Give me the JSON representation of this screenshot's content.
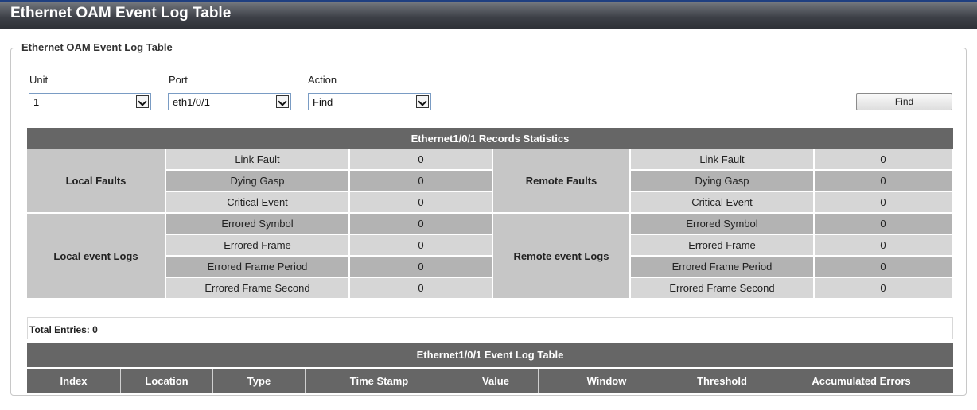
{
  "window": {
    "title": "Ethernet OAM Event Log Table"
  },
  "panel": {
    "legend": "Ethernet OAM Event Log Table"
  },
  "filters": {
    "unit": {
      "label": "Unit",
      "value": "1"
    },
    "port": {
      "label": "Port",
      "value": "eth1/0/1"
    },
    "action": {
      "label": "Action",
      "value": "Find"
    },
    "find_button": "Find"
  },
  "stats": {
    "header": "Ethernet1/0/1 Records Statistics",
    "local_faults": {
      "label": "Local Faults",
      "rows": [
        {
          "name": "Link Fault",
          "value": "0"
        },
        {
          "name": "Dying Gasp",
          "value": "0"
        },
        {
          "name": "Critical Event",
          "value": "0"
        }
      ]
    },
    "remote_faults": {
      "label": "Remote Faults",
      "rows": [
        {
          "name": "Link Fault",
          "value": "0"
        },
        {
          "name": "Dying Gasp",
          "value": "0"
        },
        {
          "name": "Critical Event",
          "value": "0"
        }
      ]
    },
    "local_event_logs": {
      "label": "Local event Logs",
      "rows": [
        {
          "name": "Errored Symbol",
          "value": "0"
        },
        {
          "name": "Errored Frame",
          "value": "0"
        },
        {
          "name": "Errored Frame Period",
          "value": "0"
        },
        {
          "name": "Errored Frame Second",
          "value": "0"
        }
      ]
    },
    "remote_event_logs": {
      "label": "Remote event Logs",
      "rows": [
        {
          "name": "Errored Symbol",
          "value": "0"
        },
        {
          "name": "Errored Frame",
          "value": "0"
        },
        {
          "name": "Errored Frame Period",
          "value": "0"
        },
        {
          "name": "Errored Frame Second",
          "value": "0"
        }
      ]
    }
  },
  "log": {
    "total_entries": "Total Entries: 0",
    "header": "Ethernet1/0/1 Event Log Table",
    "columns": [
      "Index",
      "Location",
      "Type",
      "Time Stamp",
      "Value",
      "Window",
      "Threshold",
      "Accumulated Errors"
    ]
  }
}
